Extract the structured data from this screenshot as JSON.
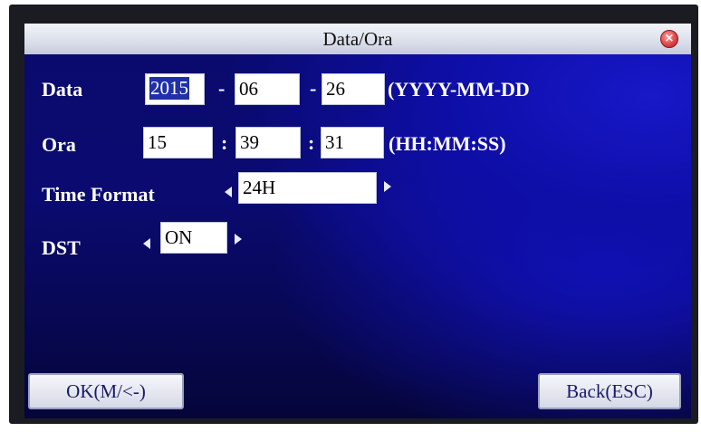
{
  "window": {
    "title": "Data/Ora",
    "close_icon": "close-icon"
  },
  "date_row": {
    "label": "Data",
    "year": "2015",
    "month": "06",
    "day": "26",
    "sep1": "-",
    "sep2": "-",
    "format": "(YYYY-MM-DD"
  },
  "time_row": {
    "label": "Ora",
    "hour": "15",
    "minute": "39",
    "second": "31",
    "sep1": ":",
    "sep2": ":",
    "format": "(HH:MM:SS)"
  },
  "time_format_row": {
    "label": "Time Format",
    "value": "24H"
  },
  "dst_row": {
    "label": "DST",
    "value": "ON"
  },
  "buttons": {
    "ok": "OK(M/<-)",
    "back": "Back(ESC)"
  },
  "colors": {
    "screen_background": "#0a0a70",
    "selection_highlight": "#2030a8",
    "label_text": "#ffffff"
  }
}
